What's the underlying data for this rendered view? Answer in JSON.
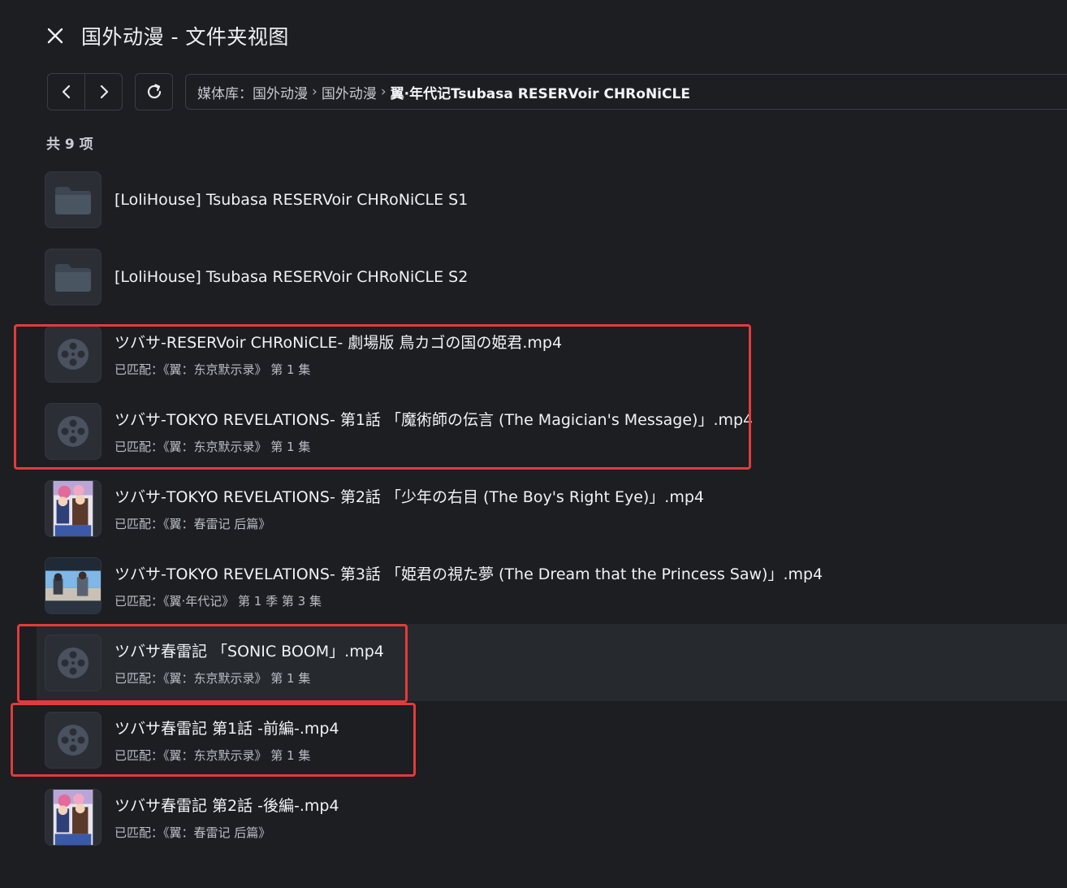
{
  "window": {
    "title": "国外动漫 - 文件夹视图"
  },
  "nav": {
    "back_label": "back",
    "forward_label": "forward",
    "refresh_label": "refresh"
  },
  "breadcrumb": {
    "items": [
      "媒体库：国外动漫",
      "国外动漫",
      "翼·年代记Tsubasa RESERVoir CHRoNiCLE"
    ],
    "separator": "›"
  },
  "count_label": "共 9 项",
  "items": [
    {
      "name": "[LoliHouse] Tsubasa RESERVoir CHRoNiCLE S1",
      "sub": "",
      "thumb": "folder-icon"
    },
    {
      "name": "[LoliHouse] Tsubasa RESERVoir CHRoNiCLE S2",
      "sub": "",
      "thumb": "folder-icon"
    },
    {
      "name": "ツバサ-RESERVoir CHRoNiCLE- 劇場版 鳥カゴの国の姫君.mp4",
      "sub": "已匹配：《翼：东京默示录》 第 1 集",
      "thumb": "film-reel-icon"
    },
    {
      "name": "ツバサ-TOKYO REVELATIONS- 第1話 「魔術師の伝言 (The Magician's Message)」.mp4",
      "sub": "已匹配：《翼：东京默示录》 第 1 集",
      "thumb": "film-reel-icon"
    },
    {
      "name": "ツバサ-TOKYO REVELATIONS- 第2話 「少年の右目 (The Boy's Right Eye)」.mp4",
      "sub": "已匹配：《翼：春雷记 后篇》",
      "thumb": "poster-thumbnail"
    },
    {
      "name": "ツバサ-TOKYO REVELATIONS- 第3話 「姫君の視た夢 (The Dream that the Princess Saw)」.mp4",
      "sub": "已匹配：《翼·年代记》 第 1 季 第 3 集",
      "thumb": "scene-thumbnail"
    },
    {
      "name": "ツバサ春雷記 「SONIC BOOM」.mp4",
      "sub": "已匹配：《翼：东京默示录》 第 1 集",
      "thumb": "film-reel-icon"
    },
    {
      "name": "ツバサ春雷記 第1話 -前編-.mp4",
      "sub": "已匹配：《翼：东京默示录》 第 1 集",
      "thumb": "film-reel-icon"
    },
    {
      "name": "ツバサ春雷記 第2話 -後編-.mp4",
      "sub": "已匹配：《翼：春雷记 后篇》",
      "thumb": "poster-thumbnail"
    }
  ],
  "colors": {
    "background": "#1c1e22",
    "highlight": "#e23b3b",
    "hover_row": "#26292e"
  }
}
